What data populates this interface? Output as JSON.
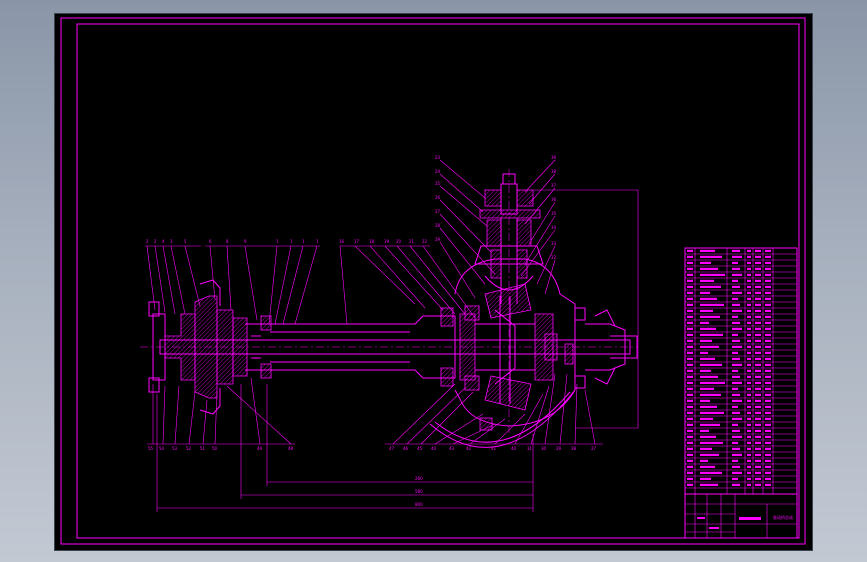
{
  "drawing": {
    "colors": {
      "line": "#ff00ff",
      "paper": "#000000",
      "desktop": "#9aa4b4"
    },
    "dimensions": {
      "overall_1": "260",
      "overall_2": "580",
      "overall_3": "800"
    },
    "title_block": {
      "name": "驱动桥总成"
    }
  }
}
